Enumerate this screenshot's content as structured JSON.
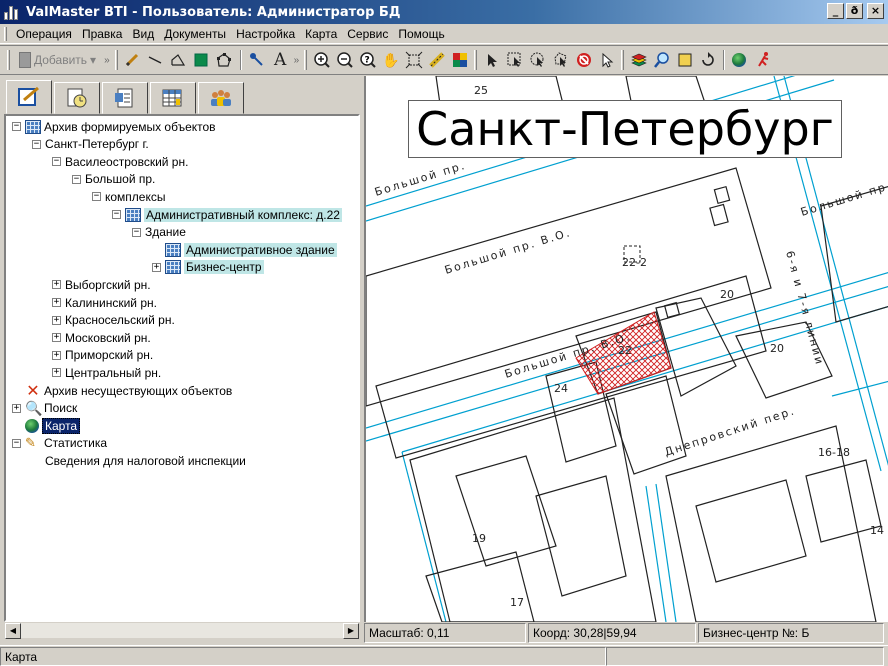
{
  "window": {
    "title": "ValMaster BTI - Пользователь: Администратор БД",
    "controls": {
      "minimize": "_",
      "maximize": "ð",
      "close": "×"
    }
  },
  "menu": [
    "Операция",
    "Правка",
    "Вид",
    "Документы",
    "Настройка",
    "Карта",
    "Сервис",
    "Помощь"
  ],
  "toolbar": {
    "add_label": "Добавить",
    "draw_tools": [
      "pencil-icon",
      "line-icon",
      "polyline-icon",
      "filled-rect-icon",
      "polygon-icon",
      "pin-icon",
      "text-icon"
    ],
    "text_tool_glyph": "A",
    "map_tools": [
      "zoom-in-icon",
      "zoom-out-icon",
      "zoom-help-icon",
      "pan-hand-icon",
      "zoom-extent-icon",
      "measure-icon",
      "layers-color-icon"
    ],
    "select_tools": [
      "arrow-select-icon",
      "rect-select-icon",
      "circle-select-icon",
      "lasso-select-icon",
      "stop-icon",
      "pointer-icon"
    ],
    "misc_tools": [
      "layers-icon",
      "find-icon",
      "frame-icon",
      "refresh-icon",
      "globe-icon",
      "run-icon"
    ]
  },
  "left_tabs": [
    "edit-tab-icon",
    "history-tab-icon",
    "report-tab-icon",
    "table-tab-icon",
    "users-tab-icon"
  ],
  "tree": [
    {
      "label": "Архив формируемых объектов",
      "level": 0,
      "toggle": "-",
      "icon": "grid"
    },
    {
      "label": "Санкт-Петербург г.",
      "level": 1,
      "toggle": "-",
      "icon": ""
    },
    {
      "label": "Василеостровский рн.",
      "level": 2,
      "toggle": "-",
      "icon": ""
    },
    {
      "label": "Большой пр.",
      "level": 3,
      "toggle": "-",
      "icon": ""
    },
    {
      "label": "комплексы",
      "level": 4,
      "toggle": "-",
      "icon": ""
    },
    {
      "label": "Административный комплекс: д.22",
      "level": 5,
      "toggle": "-",
      "icon": "grid",
      "highlight": true
    },
    {
      "label": "Здание",
      "level": 6,
      "toggle": "-",
      "icon": ""
    },
    {
      "label": "Административное здание",
      "level": 7,
      "toggle": "",
      "icon": "grid",
      "highlight": true
    },
    {
      "label": "Бизнес-центр",
      "level": 7,
      "toggle": "+",
      "icon": "grid",
      "highlight": true
    },
    {
      "label": "Выборгский рн.",
      "level": 2,
      "toggle": "+",
      "icon": ""
    },
    {
      "label": "Калининский рн.",
      "level": 2,
      "toggle": "+",
      "icon": ""
    },
    {
      "label": "Красносельский рн.",
      "level": 2,
      "toggle": "+",
      "icon": ""
    },
    {
      "label": "Московский рн.",
      "level": 2,
      "toggle": "+",
      "icon": ""
    },
    {
      "label": "Приморский рн.",
      "level": 2,
      "toggle": "+",
      "icon": ""
    },
    {
      "label": "Центральный рн.",
      "level": 2,
      "toggle": "+",
      "icon": ""
    },
    {
      "label": "Архив несуществующих объектов",
      "level": 0,
      "toggle": "",
      "icon": "x"
    },
    {
      "label": "Поиск",
      "level": 0,
      "toggle": "+",
      "icon": "mag"
    },
    {
      "label": "Карта",
      "level": 0,
      "toggle": "",
      "icon": "globe",
      "selected": true
    },
    {
      "label": "Статистика",
      "level": 0,
      "toggle": "-",
      "icon": "pencil"
    },
    {
      "label": "Сведения для налоговой инспекции",
      "level": 1,
      "toggle": "",
      "icon": ""
    }
  ],
  "map": {
    "city_title": "Санкт-Петербург",
    "street_labels": [
      "Большой пр. В.О.",
      "Большой пр. В.О.",
      "Большой пр.",
      "Большой пр.",
      "6-я и 7-я линии",
      "Днепровский пер."
    ],
    "building_numbers": [
      "25",
      "22-2",
      "20",
      "20",
      "22",
      "24",
      "16-18",
      "19",
      "17",
      "14"
    ],
    "colors": {
      "road": "#00a0d0",
      "building": "#222222",
      "hatch": "#d02020"
    }
  },
  "map_status": {
    "scale": "Масштаб: 0,11",
    "coords": "Коорд: 30,28|59,94",
    "object": "Бизнес-центр №: Б"
  },
  "status": {
    "text": "Карта"
  }
}
